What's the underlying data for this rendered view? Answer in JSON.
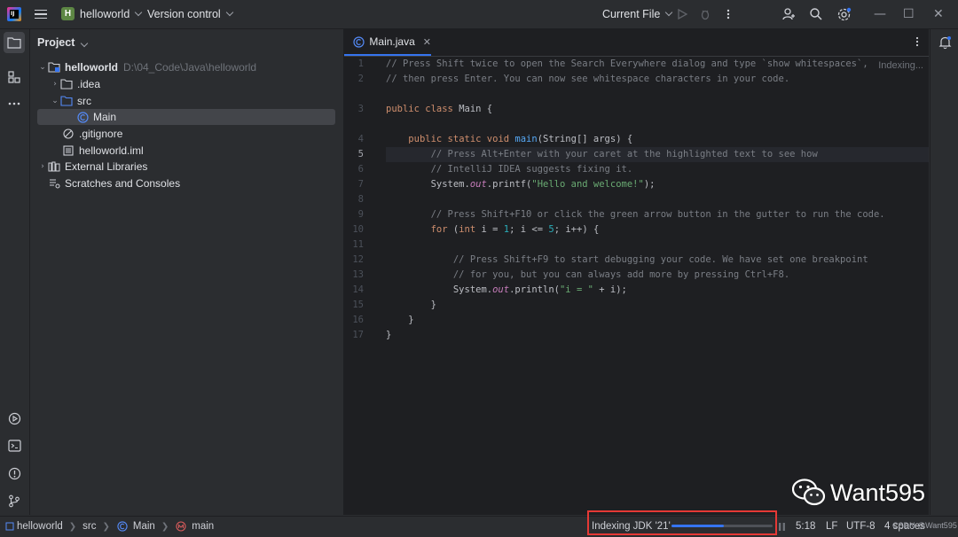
{
  "titlebar": {
    "project_badge": "H",
    "project_name": "helloworld",
    "version_control": "Version control",
    "run_config": "Current File"
  },
  "project_panel": {
    "title": "Project",
    "tree": [
      {
        "label": "helloworld",
        "hint": "D:\\04_Code\\Java\\helloworld"
      },
      {
        "label": ".idea"
      },
      {
        "label": "src"
      },
      {
        "label": "Main"
      },
      {
        "label": ".gitignore"
      },
      {
        "label": "helloworld.iml"
      },
      {
        "label": "External Libraries"
      },
      {
        "label": "Scratches and Consoles"
      }
    ]
  },
  "editor": {
    "tab_label": "Main.java",
    "status_hint": "Indexing...",
    "current_line": 5,
    "lines": [
      "1",
      "2",
      "3",
      "4",
      "5",
      "6",
      "7",
      "8",
      "9",
      "10",
      "11",
      "12",
      "13",
      "14",
      "15",
      "16",
      "17"
    ]
  },
  "statusbar": {
    "breadcrumb": [
      "helloworld",
      "src",
      "Main",
      "main"
    ],
    "indexing_text": "Indexing JDK '21'",
    "indexing_progress": 0.52,
    "position": "5:18",
    "line_ending": "LF",
    "encoding": "UTF-8",
    "indent": "4 spaces"
  },
  "watermark": {
    "text": "Want595",
    "small": "CSDN @Want595"
  },
  "colors": {
    "accent": "#3574f0",
    "highlight_box": "#e53935",
    "project_badge": "#5d8744"
  },
  "icons": [
    "folder-icon",
    "structure-icon",
    "more-icon",
    "run-icon",
    "terminal-icon",
    "problems-icon",
    "git-icon",
    "notifications-icon",
    "search-icon",
    "settings-icon",
    "add-user-icon"
  ]
}
